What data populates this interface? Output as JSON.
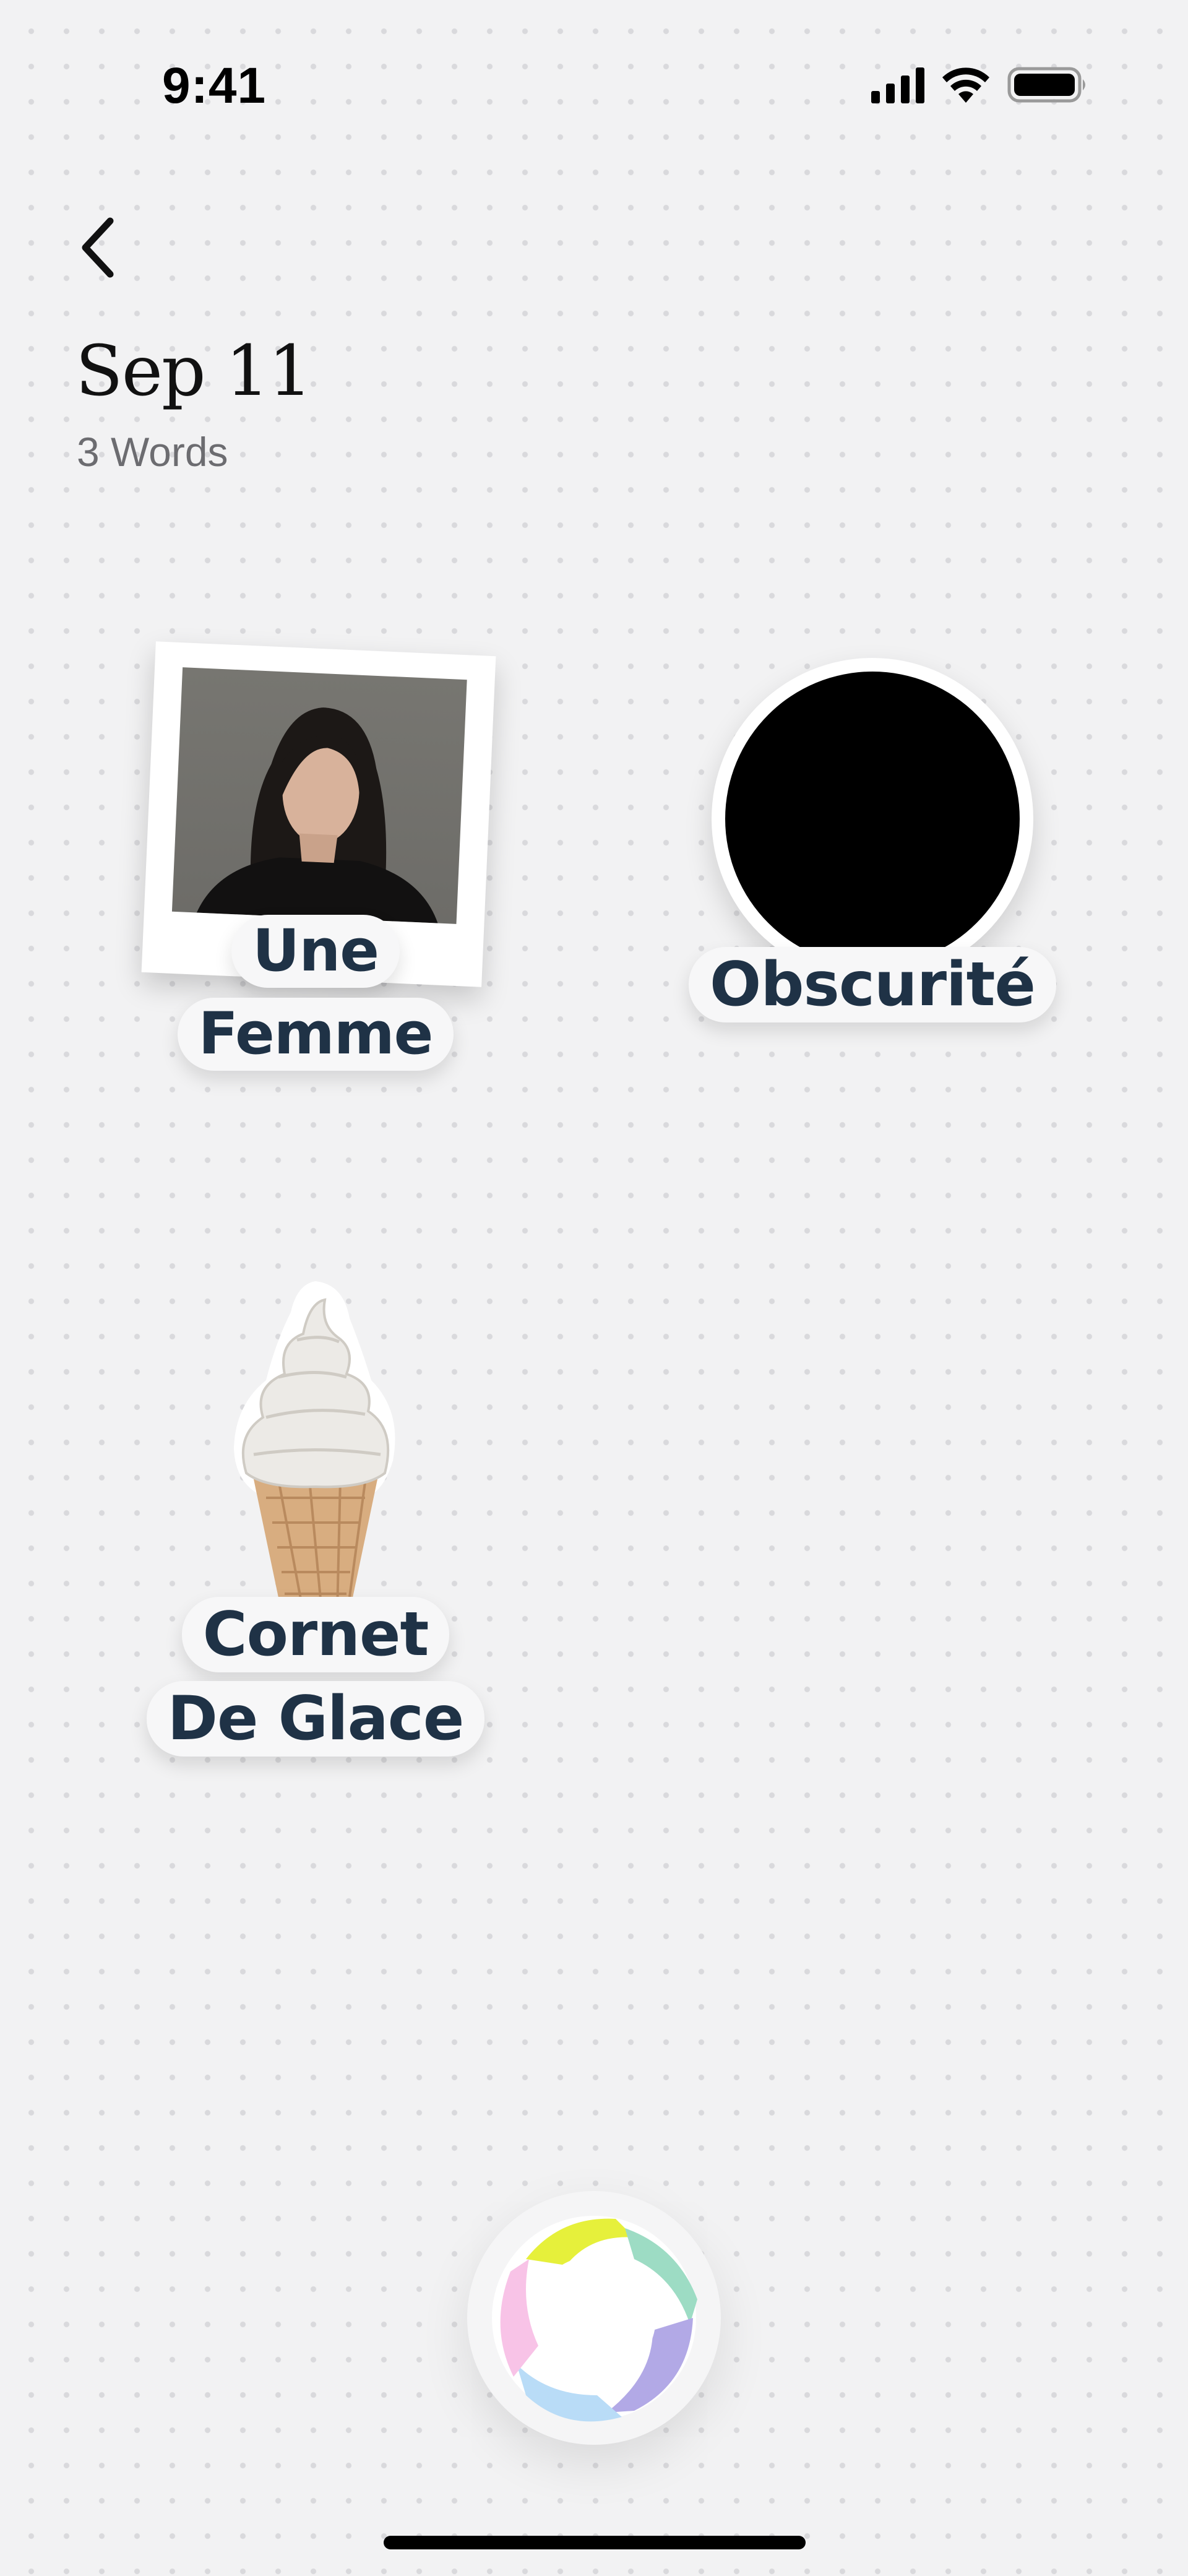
{
  "status_bar": {
    "time": "9:41"
  },
  "header": {
    "title": "Sep 11",
    "subtitle": "3 Words"
  },
  "words": [
    {
      "label_line1": "Une",
      "label_line2": "Femme"
    },
    {
      "label": "Obscurité"
    },
    {
      "label_line1": "Cornet",
      "label_line2": "De Glace"
    }
  ],
  "fab_colors": [
    "#e5f03a",
    "#9ddcc4",
    "#b2a9e6",
    "#b8dcf7",
    "#f7c2e6"
  ],
  "colors": {
    "label_text": "#1f3246",
    "background": "#f2f2f3"
  }
}
